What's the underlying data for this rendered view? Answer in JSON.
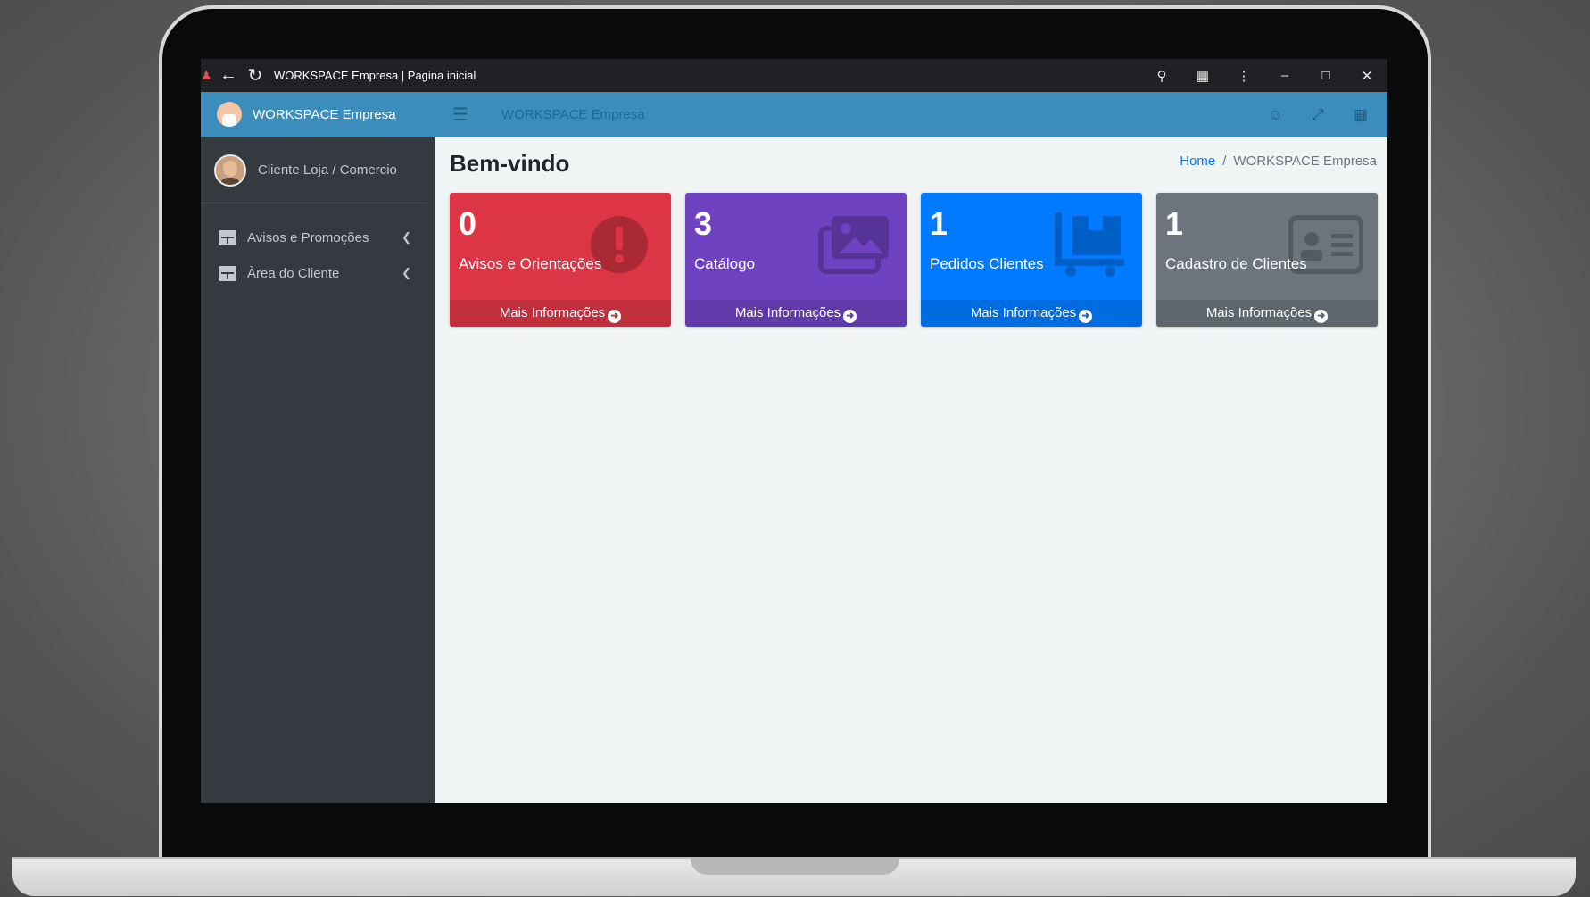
{
  "browser": {
    "title": "WORKSPACE Empresa | Pagina inicial",
    "favicon_icon": "person-icon",
    "nav_icons": [
      "back-arrow-icon",
      "reload-icon"
    ],
    "right_icons": [
      "key-icon",
      "extension-icon",
      "kebab-menu-icon",
      "minimize-icon",
      "maximize-icon",
      "close-icon"
    ]
  },
  "sidebar": {
    "brand": "WORKSPACE Empresa",
    "user_name": "Cliente Loja / Comercio",
    "items": [
      {
        "label": "Avisos e Promoções",
        "icon": "table-icon"
      },
      {
        "label": "Àrea do Cliente",
        "icon": "table-icon"
      }
    ]
  },
  "navbar": {
    "title": "WORKSPACE Empresa",
    "right_icons": [
      "user-icon",
      "fullscreen-icon",
      "grid-icon"
    ]
  },
  "content": {
    "page_title": "Bem-vindo",
    "breadcrumb": {
      "home": "Home",
      "current": "WORKSPACE Empresa"
    },
    "cards": [
      {
        "count": "0",
        "label": "Avisos e Orientações",
        "footer": "Mais Informações",
        "color": "#dc3545",
        "icon": "exclamation-circle-icon"
      },
      {
        "count": "3",
        "label": "Catálogo",
        "footer": "Mais Informações",
        "color": "#6f42c1",
        "icon": "images-icon"
      },
      {
        "count": "1",
        "label": "Pedidos Clientes",
        "footer": "Mais Informações",
        "color": "#007bff",
        "icon": "dolly-icon"
      },
      {
        "count": "1",
        "label": "Cadastro de Clientes",
        "footer": "Mais Informações",
        "color": "#6c757d",
        "icon": "id-card-icon"
      }
    ]
  },
  "colors": {
    "navbar": "#3c8dbc",
    "sidebar": "#343a40",
    "content_bg": "#f1f4f5"
  }
}
